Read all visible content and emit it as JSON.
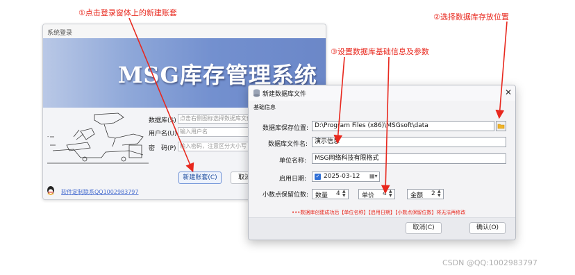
{
  "annotations": {
    "step1": "①点击登录窗体上的新建账套",
    "step2": "②选择数据库存放位置",
    "step3": "③设置数据库基础信息及参数"
  },
  "login": {
    "title": "系统登录",
    "banner_title": "MSG库存管理系统",
    "db_label": "数据库(S)",
    "db_placeholder": "点击右侧图标选择数据库文件",
    "user_label": "用户名(U)",
    "user_placeholder": "输入用户名",
    "pwd_label": "密　码(P)",
    "pwd_placeholder": "输入密码，注意区分大小写",
    "new_button": "新建账套(C)",
    "cancel_button": "取消",
    "link_text": "软件定制联系QQ1002983797"
  },
  "dialog": {
    "title": "新建数据库文件",
    "section": "基础信息",
    "path_label": "数据库保存位置:",
    "path_value": "D:\\Program Files (x86)\\MSGsoft\\data",
    "filename_label": "数据库文件名:",
    "filename_value": "演示信息",
    "company_label": "单位名称:",
    "company_value": "MSG网络科技有限格式",
    "date_label": "启用日期:",
    "date_value": "2025-03-12",
    "decimals_label": "小数点保留位数:",
    "qty_label": "数量",
    "qty_value": "4",
    "price_label": "单价",
    "price_value": "4",
    "amount_label": "金额",
    "amount_value": "2",
    "warning": "•••数据库创建成功后【单位名称】【启用日期】【小数点保留位数】将无法再修改",
    "cancel_button": "取消(C)",
    "ok_button": "确认(O)"
  },
  "watermark": "CSDN @QQ:1002983797",
  "colors": {
    "annotation": "#e8281e",
    "banner": "#7390cf",
    "checkbox": "#2f6fd6"
  }
}
